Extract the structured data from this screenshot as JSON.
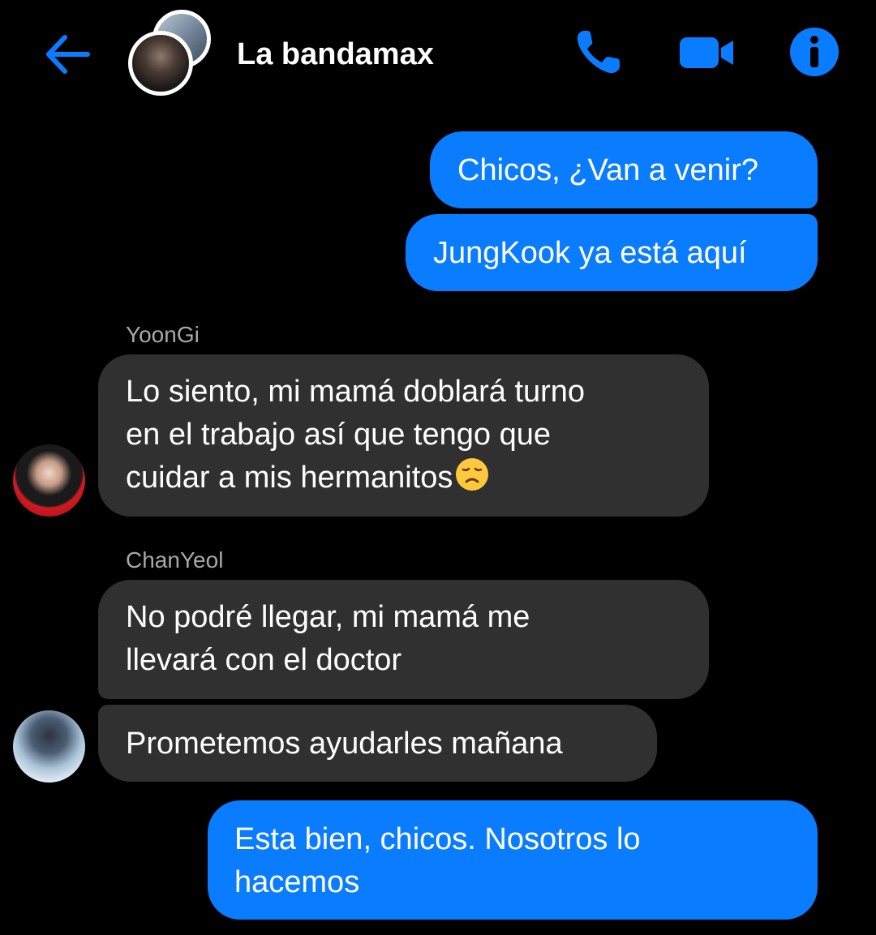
{
  "header": {
    "title": "La bandamax",
    "back_icon": "arrow-left-icon",
    "call_icon": "phone-icon",
    "video_icon": "video-camera-icon",
    "info_icon": "info-icon",
    "accent_color": "#0a7cff"
  },
  "messages": [
    {
      "direction": "outgoing",
      "text": "Chicos, ¿Van a venir?"
    },
    {
      "direction": "outgoing",
      "text": "JungKook ya está aquí"
    },
    {
      "direction": "incoming",
      "sender": "YoonGi",
      "lines": [
        "Lo siento, mi mamá doblará turno",
        "en el trabajo así que tengo que",
        "cuidar a mis hermanitos"
      ],
      "emoji": "disappointed-face"
    },
    {
      "direction": "incoming",
      "sender": "ChanYeol",
      "lines": [
        "No podré llegar, mi mamá me",
        "llevará con el doctor"
      ]
    },
    {
      "direction": "incoming",
      "text": "Prometemos ayudarles mañana"
    },
    {
      "direction": "outgoing",
      "lines": [
        "Esta bien, chicos. Nosotros lo",
        "hacemos"
      ]
    }
  ],
  "colors": {
    "outgoing_bubble": "#0a7cff",
    "incoming_bubble": "#303030",
    "background": "#000000",
    "sender_name": "#a8a8a8"
  }
}
